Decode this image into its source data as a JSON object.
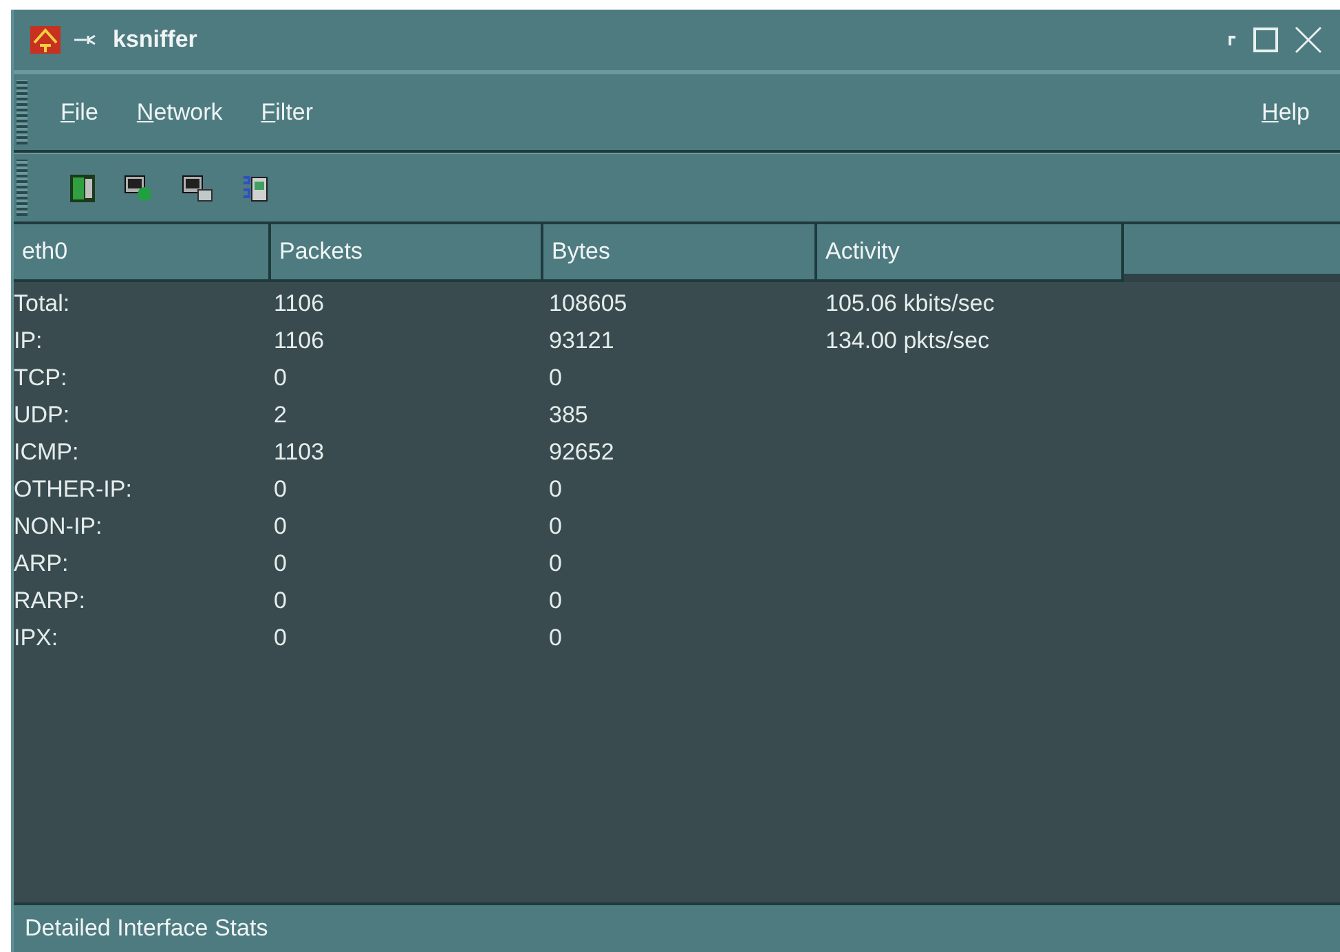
{
  "window": {
    "title": "ksniffer"
  },
  "menu": {
    "left": [
      "File",
      "Network",
      "Filter"
    ],
    "right": [
      "Help"
    ]
  },
  "toolbar": {
    "buttons": [
      {
        "kind": "card"
      },
      {
        "kind": "connect"
      },
      {
        "kind": "network"
      },
      {
        "kind": "stats"
      }
    ]
  },
  "table": {
    "columns": [
      "eth0",
      "Packets",
      "Bytes",
      "Activity"
    ],
    "rows": [
      [
        "Total:",
        "1106",
        "108605",
        "105.06 kbits/sec"
      ],
      [
        "IP:",
        "1106",
        "93121",
        "134.00 pkts/sec"
      ],
      [
        "TCP:",
        "0",
        "0",
        ""
      ],
      [
        "UDP:",
        "2",
        "385",
        ""
      ],
      [
        "ICMP:",
        "1103",
        "92652",
        ""
      ],
      [
        "OTHER-IP:",
        "0",
        "0",
        ""
      ],
      [
        "NON-IP:",
        "0",
        "0",
        ""
      ],
      [
        "ARP:",
        "0",
        "0",
        ""
      ],
      [
        "RARP:",
        "0",
        "0",
        ""
      ],
      [
        "IPX:",
        "0",
        "0",
        ""
      ]
    ]
  },
  "status_bar": "Detailed Interface Stats"
}
